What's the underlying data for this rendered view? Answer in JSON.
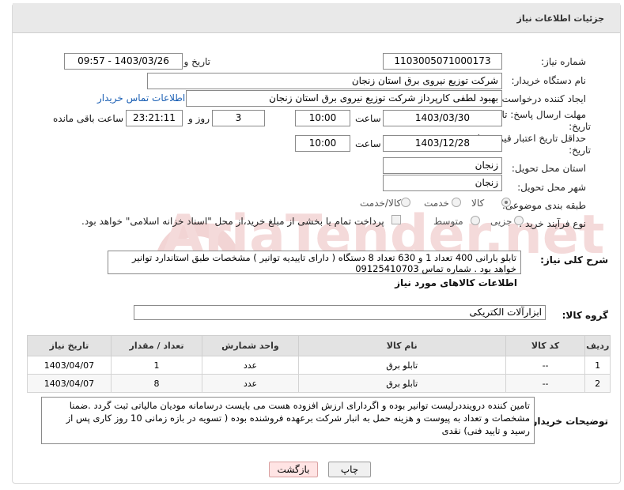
{
  "header": {
    "title": "جزئیات اطلاعات نیاز"
  },
  "form": {
    "need_number_label": "شماره نیاز:",
    "need_number": "1103005071000173",
    "announce_label": "تاریخ و ساعت اعلان عمومی:",
    "announce_value": "1403/03/26 - 09:57",
    "buyer_org_label": "نام دستگاه خریدار:",
    "buyer_org": "شرکت توزیع نیروی برق استان زنجان",
    "creator_label": "ایجاد کننده درخواست:",
    "creator": "بهبود لطفی کارپرداز شرکت توزیع نیروی برق استان زنجان",
    "contact_link": "اطلاعات تماس خریدار",
    "deadline_label_1": "مهلت ارسال پاسخ: تا",
    "deadline_label_2": "تاریخ:",
    "deadline_date": "1403/03/30",
    "time_label": "ساعت",
    "deadline_time": "10:00",
    "days_value": "3",
    "days_label": "روز و",
    "remaining_time": "23:21:11",
    "remaining_label": "ساعت باقی مانده",
    "validity_label_1": "حداقل تاریخ اعتبار قیمت: تا",
    "validity_label_2": "تاریخ:",
    "validity_date": "1403/12/28",
    "validity_time": "10:00",
    "province_label": "استان محل تحویل:",
    "province": "زنجان",
    "city_label": "شهر محل تحویل:",
    "city": "زنجان",
    "category_label": "طبقه بندی موضوعی:",
    "category_options": [
      "کالا",
      "خدمت",
      "کالا/خدمت"
    ],
    "category_selected": "کالا",
    "process_label": "نوع فرآیند خرید :",
    "process_options": [
      "جزیی",
      "متوسط"
    ],
    "payment_note": "پرداخت تمام یا بخشی از مبلغ خرید،از محل \"اسناد خزانه اسلامی\" خواهد بود."
  },
  "description": {
    "label": "شرح کلی نیاز:",
    "text": "تابلو بارانی 400 تعداد 1 و 630 تعداد 8 دستگاه ( دارای تاییدیه توانیر ) مشخصات طبق استاندارد توانیر خواهد بود . شماره تماس 09125410703"
  },
  "goods": {
    "section_title": "اطلاعات کالاهای مورد نیاز",
    "group_label": "گروه کالا:",
    "group_value": "ابزارآلات الکتریکی",
    "columns": [
      "ردیف",
      "کد کالا",
      "نام کالا",
      "واحد شمارش",
      "تعداد / مقدار",
      "تاریخ نیاز"
    ],
    "rows": [
      {
        "row": "1",
        "code": "--",
        "name": "تابلو برق",
        "unit": "عدد",
        "qty": "1",
        "date": "1403/04/07"
      },
      {
        "row": "2",
        "code": "--",
        "name": "تابلو برق",
        "unit": "عدد",
        "qty": "8",
        "date": "1403/04/07"
      }
    ]
  },
  "buyer_notes": {
    "label": "توضیحات خریدار:",
    "text": "تامین کننده دروینددرلیست توانیر بوده و اگردارای ارزش افزوده هست می بایست درسامانه مودیان مالیاتی ثبت گردد .ضمنا مشخصات و تعداد به پیوست و هزینه حمل به انبار شرکت برعهده فروشنده بوده ( تسویه در بازه زمانی 10 روز کاری پس از رسید و تایید فنی) نقدی"
  },
  "buttons": {
    "print": "چاپ",
    "back": "بازگشت"
  }
}
